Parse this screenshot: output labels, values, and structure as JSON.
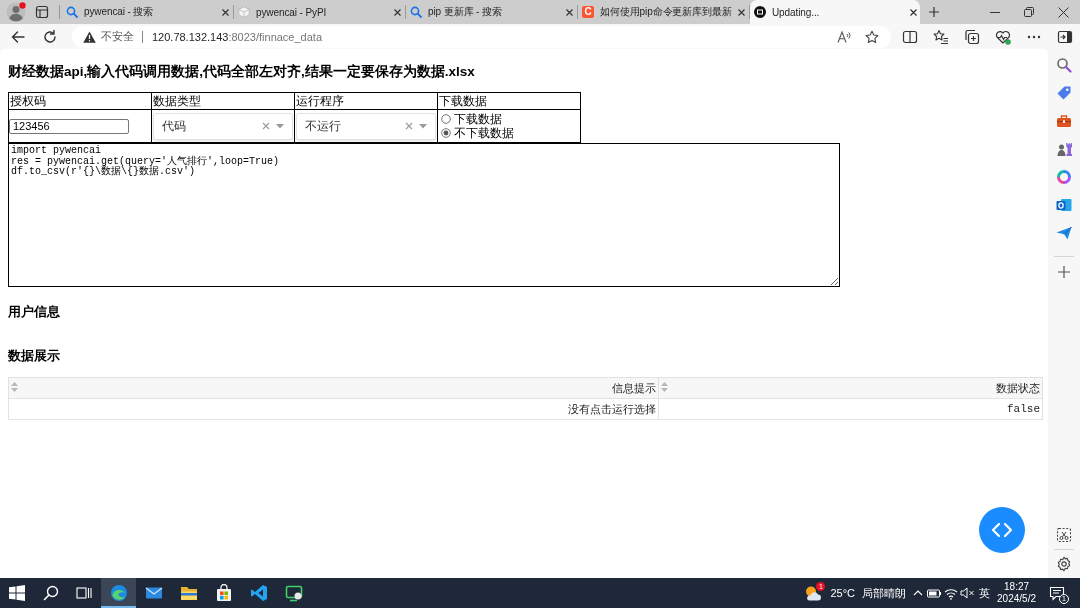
{
  "browser": {
    "profile": {
      "notification": true
    },
    "tabs": [
      {
        "kind": "search",
        "title": "pywencai - 搜索",
        "selected": false
      },
      {
        "kind": "package",
        "title": "pywencai - PyPI",
        "selected": false
      },
      {
        "kind": "search",
        "title": "pip 更新库 - 搜索",
        "selected": false
      },
      {
        "kind": "letter",
        "letter": "C",
        "title": "如何使用pip命令更新库到最新",
        "selected": false
      },
      {
        "kind": "site",
        "title": "Updating...",
        "selected": true
      }
    ],
    "address": {
      "security": "不安全",
      "host": "120.78.132.143",
      "path": ":8023/finnace_data"
    }
  },
  "page": {
    "title": "财经数据api,输入代码调用数据,代码全部左对齐,结果一定要保存为数据.xlsx",
    "form": {
      "columns": [
        "授权码",
        "数据类型",
        "运行程序",
        "下载数据"
      ],
      "token": {
        "value": "123456"
      },
      "selects": [
        {
          "value": "代码"
        },
        {
          "value": "不运行"
        }
      ],
      "download": [
        {
          "label": "下载数据",
          "selected": false
        },
        {
          "label": "不下载数据",
          "selected": true
        }
      ]
    },
    "code": {
      "value": "import pywencai\nres = pywencai.get(query='人气排行',loop=True)\ndf.to_csv(r'{}\\数据\\{}数据.csv')"
    },
    "sections": [
      {
        "title": "用户信息"
      },
      {
        "title": "数据展示",
        "table": {
          "columns": [
            "信息提示",
            "数据状态"
          ],
          "rows": [
            [
              "没有点击运行选择",
              "false"
            ]
          ]
        }
      }
    ]
  },
  "taskbar": {
    "apps": [
      {
        "kind": "browser",
        "selected": true
      },
      {
        "kind": "mail",
        "selected": false
      },
      {
        "kind": "folder",
        "selected": false
      },
      {
        "kind": "store",
        "selected": false
      },
      {
        "kind": "code",
        "selected": false
      },
      {
        "kind": "monitor",
        "selected": false
      }
    ],
    "weather": {
      "badge": "1",
      "temperature": "25°C",
      "condition": "局部晴朗"
    },
    "input_method": "英",
    "clock": {
      "time": "18:27",
      "date": "2024/5/2"
    },
    "notifications": "1"
  }
}
